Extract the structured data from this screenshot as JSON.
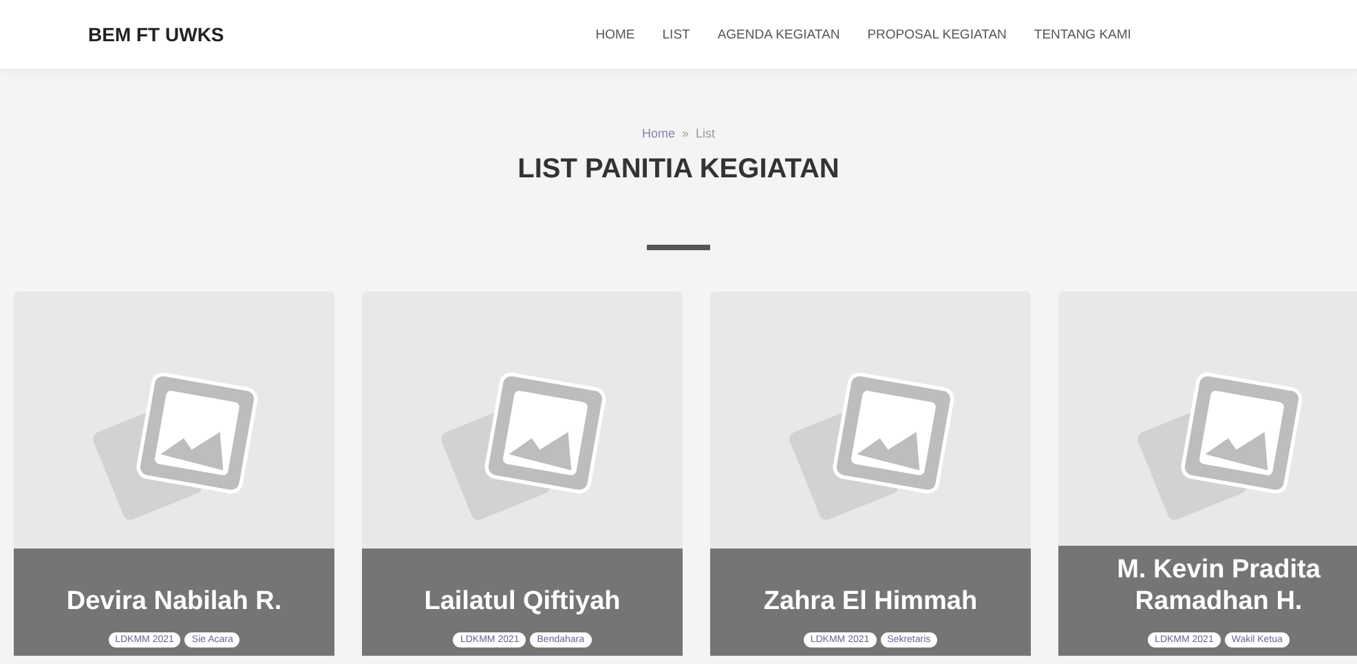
{
  "navbar": {
    "brand": "BEM FT UWKS",
    "links": [
      "HOME",
      "LIST",
      "AGENDA KEGIATAN",
      "PROPOSAL KEGIATAN",
      "TENTANG KAMI"
    ]
  },
  "breadcrumb": [
    "Home",
    "»",
    "List"
  ],
  "heading": "LIST PANITIA KEGIATAN",
  "cards": [
    {
      "name": "Devira Nabilah R.",
      "tags": [
        "LDKMM 2021",
        "Sie Acara"
      ]
    },
    {
      "name": "Lailatul Qiftiyah",
      "tags": [
        "LDKMM 2021",
        "Bendahara"
      ]
    },
    {
      "name": "Zahra El Himmah",
      "tags": [
        "LDKMM 2021",
        "Sekretaris"
      ]
    },
    {
      "name": "M. Kevin Pradita Ramadhan H.",
      "tags": [
        "LDKMM 2021",
        "Wakil Ketua"
      ]
    }
  ]
}
